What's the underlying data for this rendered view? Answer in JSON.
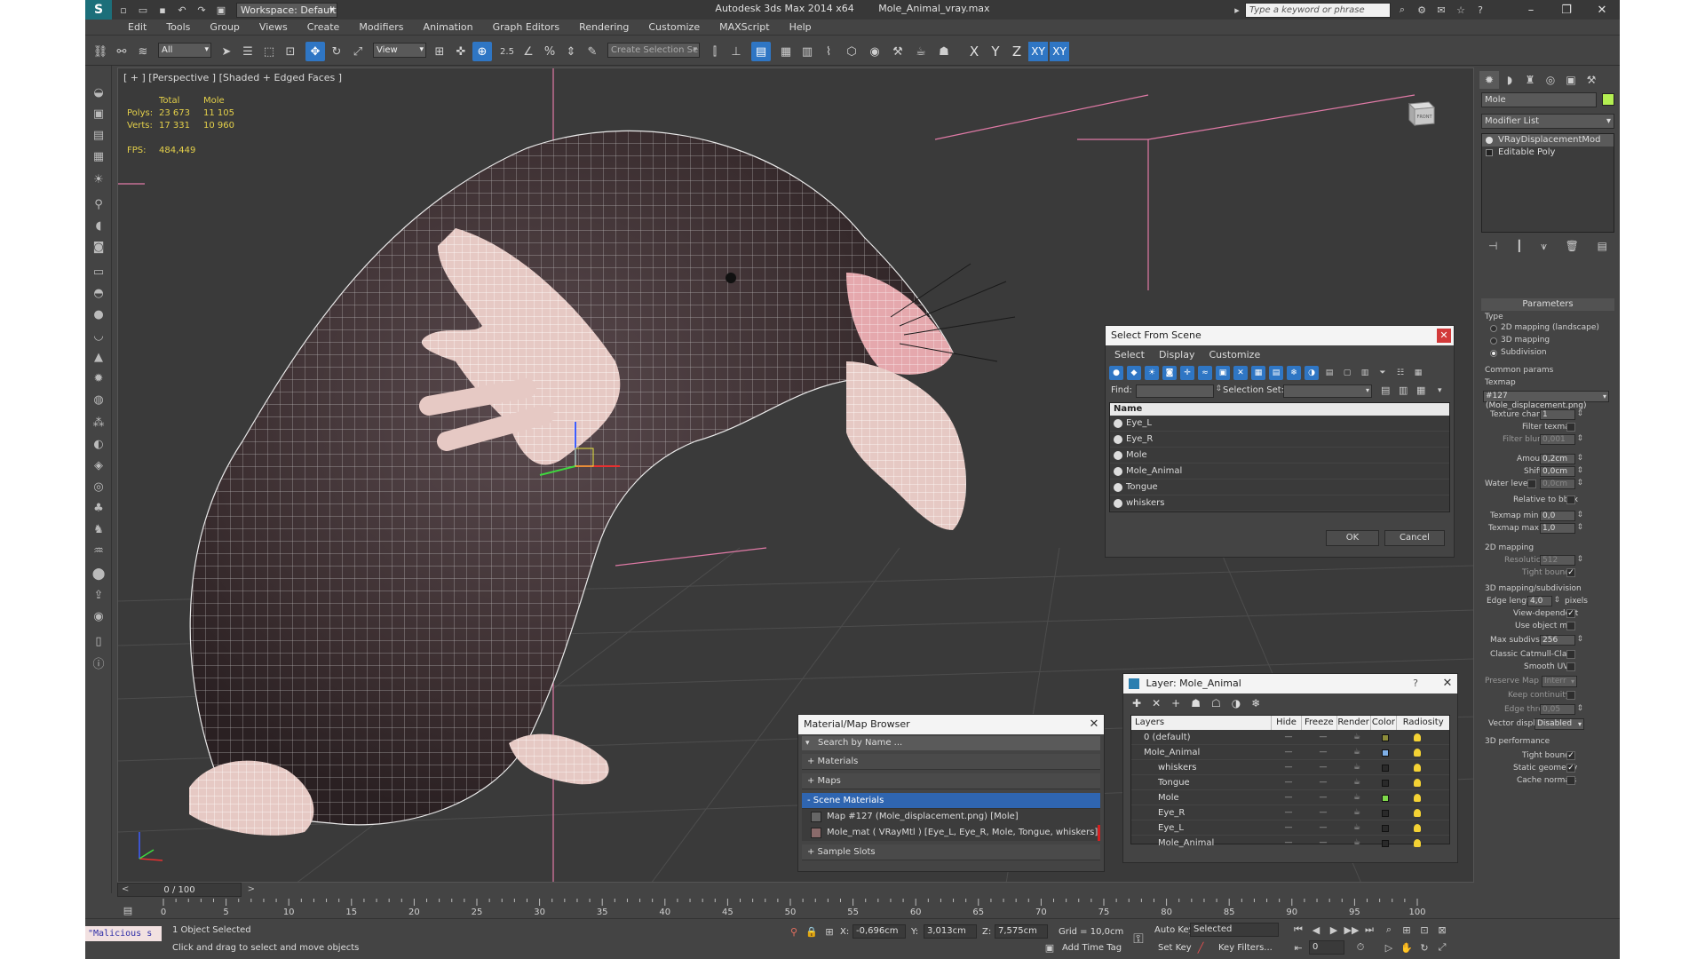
{
  "titlebar": {
    "workspace": "Workspace: Default",
    "app_name": "Autodesk 3ds Max  2014 x64",
    "file_name": "Mole_Animal_vray.max",
    "search_placeholder": "Type a keyword or phrase"
  },
  "menu": [
    "Edit",
    "Tools",
    "Group",
    "Views",
    "Create",
    "Modifiers",
    "Animation",
    "Graph Editors",
    "Rendering",
    "Customize",
    "MAXScript",
    "Help"
  ],
  "toolbar": {
    "filter": "All",
    "ref_coord": "View",
    "snap_label": "2.5",
    "named_sel": "Create Selection Se",
    "axes": [
      "X",
      "Y",
      "Z",
      "XY",
      "XY"
    ]
  },
  "viewport": {
    "label": "[ + ] [Perspective ] [Shaded + Edged Faces ]",
    "stats": {
      "total_label": "Total",
      "obj_label": "Mole",
      "polys_label": "Polys:",
      "polys_total": "23 673",
      "polys_obj": "11 105",
      "verts_label": "Verts:",
      "verts_total": "17 331",
      "verts_obj": "10 960",
      "fps_label": "FPS:",
      "fps": "484,449"
    },
    "viewcube_label": "FRONT"
  },
  "select_from_scene": {
    "title": "Select From Scene",
    "menu": [
      "Select",
      "Display",
      "Customize"
    ],
    "find_label": "Find:",
    "selection_set_label": "Selection Set:",
    "column_name": "Name",
    "items": [
      "Eye_L",
      "Eye_R",
      "Mole",
      "Mole_Animal",
      "Tongue",
      "whiskers"
    ],
    "ok": "OK",
    "cancel": "Cancel"
  },
  "material_browser": {
    "title": "Material/Map Browser",
    "search": "Search by Name ...",
    "cat_materials": "+ Materials",
    "cat_maps": "+ Maps",
    "cat_scene": "- Scene Materials",
    "item_map": "Map #127 (Mole_displacement.png) [Mole]",
    "item_mat": "Mole_mat  ( VRayMtl )  [Eye_L, Eye_R, Mole, Tongue, whiskers]",
    "cat_samples": "+ Sample Slots"
  },
  "layer_manager": {
    "title": "Layer: Mole_Animal",
    "help": "?",
    "columns": [
      "Layers",
      "Hide",
      "Freeze",
      "Render",
      "Color",
      "Radiosity"
    ],
    "rows": [
      {
        "name": "0 (default)",
        "indent": 0,
        "color": "#8c8c3a"
      },
      {
        "name": "Mole_Animal",
        "indent": 0,
        "color": "#7fb0e8"
      },
      {
        "name": "whiskers",
        "indent": 1,
        "color": "#2a2a2a"
      },
      {
        "name": "Tongue",
        "indent": 1,
        "color": "#2a2a2a"
      },
      {
        "name": "Mole",
        "indent": 1,
        "color": "#7fd84a"
      },
      {
        "name": "Eye_R",
        "indent": 1,
        "color": "#2a2a2a"
      },
      {
        "name": "Eye_L",
        "indent": 1,
        "color": "#2a2a2a"
      },
      {
        "name": "Mole_Animal",
        "indent": 1,
        "color": "#2a2a2a"
      }
    ]
  },
  "command_panel": {
    "object_name": "Mole",
    "modifier_list": "Modifier List",
    "stack": [
      "VRayDisplacementMod",
      "Editable Poly"
    ],
    "parameters": "Parameters",
    "type_label": "Type",
    "type_2d": "2D mapping (landscape)",
    "type_3d": "3D mapping",
    "type_subdiv": "Subdivision",
    "common_params": "Common params",
    "texmap_label": "Texmap",
    "texmap_value": "#127 (Mole_displacement.png)",
    "texture_chan": "Texture chan",
    "texture_chan_val": "1",
    "filter_texmap": "Filter texmap",
    "filter_blur": "Filter blur",
    "filter_blur_val": "0,001",
    "amount": "Amount",
    "amount_val": "0,2cm",
    "shift": "Shift",
    "shift_val": "0,0cm",
    "water_level": "Water level",
    "water_level_val": "0,0cm",
    "relative_bbox": "Relative to bbox",
    "texmap_min": "Texmap min",
    "texmap_min_val": "0,0",
    "texmap_max": "Texmap max",
    "texmap_max_val": "1,0",
    "mapping2d": "2D mapping",
    "resolution": "Resolution",
    "resolution_val": "512",
    "tight_bounds": "Tight bounds",
    "mapping3d": "3D mapping/subdivision",
    "edge_length": "Edge length",
    "edge_length_val": "4,0",
    "pixels": "pixels",
    "view_dependent": "View-dependent",
    "use_object_mtl": "Use object mtl",
    "max_subdivs": "Max subdivs",
    "max_subdivs_val": "256",
    "classic_cc": "Classic Catmull-Clark",
    "smooth_uvs": "Smooth UVs",
    "preserve_map": "Preserve Map Bnd",
    "preserve_map_val": "Interr",
    "keep_continuity": "Keep continuity",
    "edge_thresh": "Edge thresh",
    "edge_thresh_val": "0,05",
    "vector_displ": "Vector displ",
    "vector_displ_val": "Disabled",
    "perf": "3D performance",
    "tight_bounds2": "Tight bounds",
    "static_geom": "Static geometry",
    "cache_normals": "Cache normals"
  },
  "timeline": {
    "frame": "0 / 100",
    "ticks": [
      "0",
      "5",
      "10",
      "15",
      "20",
      "25",
      "30",
      "35",
      "40",
      "45",
      "50",
      "55",
      "60",
      "65",
      "70",
      "75",
      "80",
      "85",
      "90",
      "95",
      "100"
    ]
  },
  "statusbar": {
    "maxscript": "\"Malicious s",
    "selected": "1 Object Selected",
    "prompt": "Click and drag to select and move objects",
    "x_label": "X:",
    "x_val": "-0,696cm",
    "y_label": "Y:",
    "y_val": "3,013cm",
    "z_label": "Z:",
    "z_val": "7,575cm",
    "grid": "Grid = 10,0cm",
    "auto_key": "Auto Key",
    "set_key": "Set Key",
    "selected_drop": "Selected",
    "key_filters": "Key Filters...",
    "add_time_tag": "Add Time Tag",
    "frame_val": "0"
  }
}
